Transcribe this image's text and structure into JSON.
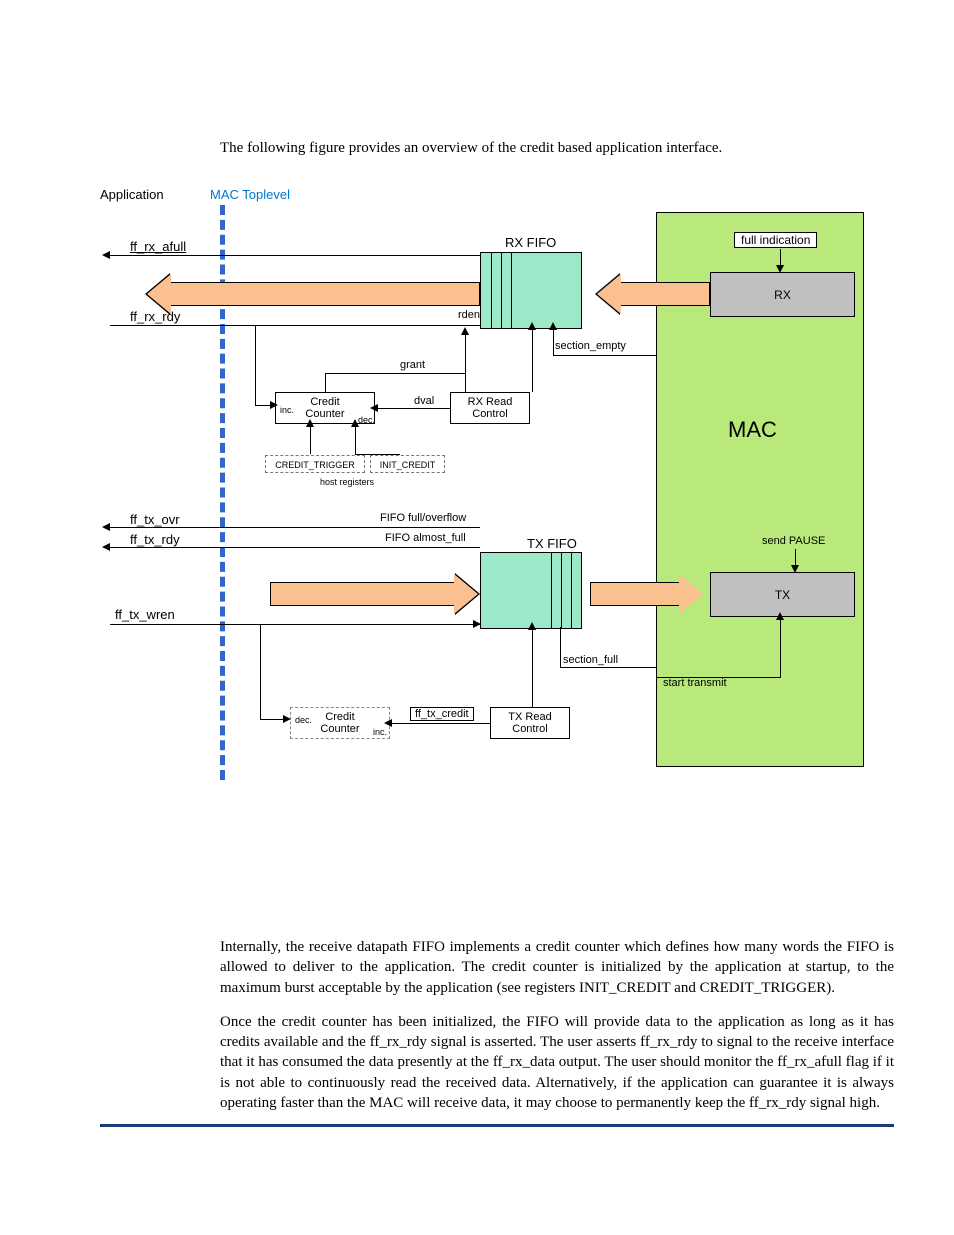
{
  "intro": "The following figure provides an overview of the credit based application interface.",
  "diagram": {
    "application": "Application",
    "mac_toplevel": "MAC Toplevel",
    "ff_rx_afull": "ff_rx_afull",
    "ff_rx_rdy": "ff_rx_rdy",
    "rx_fifo": "RX FIFO",
    "full_indication": "full indication",
    "rx_block": "RX",
    "rden": "rden",
    "section_empty": "section_empty",
    "grant": "grant",
    "credit_counter": "Credit\nCounter",
    "inc": "inc.",
    "dec": "dec.",
    "dval": "dval",
    "rx_read_control": "RX Read\nControl",
    "credit_trigger": "CREDIT_TRIGGER",
    "init_credit": "INIT_CREDIT",
    "host_registers": "host registers",
    "mac_title": "MAC",
    "ff_tx_ovr": "ff_tx_ovr",
    "ff_tx_rdy": "ff_tx_rdy",
    "fifo_full_overflow": "FIFO full/overflow",
    "fifo_almost_full": "FIFO almost_full",
    "tx_fifo": "TX FIFO",
    "send_pause": "send PAUSE",
    "tx_block": "TX",
    "ff_tx_wren": "ff_tx_wren",
    "section_full": "section_full",
    "start_transmit": "start transmit",
    "ff_tx_credit": "ff_tx_credit",
    "tx_read_control": "TX Read\nControl"
  },
  "body": {
    "p1": "Internally, the receive datapath FIFO implements a credit counter which defines how many words the FIFO is allowed to deliver to the application. The credit counter is initialized by the application at startup, to the maximum burst acceptable by the application (see registers INIT_CREDIT and CREDIT_TRIGGER).",
    "p2": "Once the credit counter has been initialized, the FIFO will provide data to the application as long as it has credits available and the ff_rx_rdy signal is asserted.  The user asserts ff_rx_rdy to signal to the receive interface that it has consumed the data presently at the ff_rx_data output.  The user should monitor the ff_rx_afull flag if it is not able to continuously read the received data.  Alternatively, if the application can guarantee it is always operating faster than the MAC will receive data, it may choose to permanently keep the ff_rx_rdy signal high."
  }
}
